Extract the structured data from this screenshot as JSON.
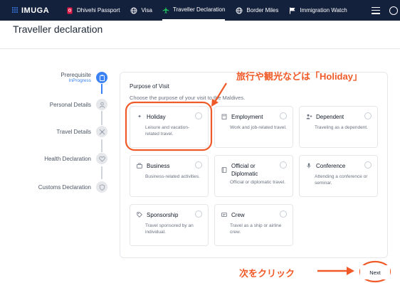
{
  "nav": {
    "logo": "IMUGA",
    "items": [
      {
        "label": "Dhivehi Passport",
        "icon": "passport-icon"
      },
      {
        "label": "Visa",
        "icon": "globe-icon"
      },
      {
        "label": "Traveller Declaration",
        "icon": "airplane-icon"
      },
      {
        "label": "Border Miles",
        "icon": "globe-icon"
      },
      {
        "label": "Immigration Watch",
        "icon": "flag-icon"
      }
    ],
    "right_icons": [
      "menu-icon",
      "chat-icon"
    ]
  },
  "page": {
    "title": "Traveller declaration"
  },
  "stepper": {
    "steps": [
      {
        "label": "Prerequisite",
        "status": "InProgress",
        "icon": "clipboard-icon",
        "active": true
      },
      {
        "label": "Personal Details",
        "icon": "person-icon",
        "active": false
      },
      {
        "label": "Travel Details",
        "icon": "airplane-icon",
        "active": false
      },
      {
        "label": "Health Declaration",
        "icon": "heart-icon",
        "active": false
      },
      {
        "label": "Customs Declaration",
        "icon": "shield-icon",
        "active": false
      }
    ]
  },
  "form": {
    "title": "Purpose of Visit",
    "subtitle": "Choose the purpose of your visit to the Maldives.",
    "options": [
      {
        "label": "Holiday",
        "desc": "Leisure and vacation-related travel.",
        "icon": "sparkle-icon"
      },
      {
        "label": "Employment",
        "desc": "Work and job-related travel.",
        "icon": "building-icon"
      },
      {
        "label": "Dependent",
        "desc": "Traveling as a dependent.",
        "icon": "person-plus-icon"
      },
      {
        "label": "Business",
        "desc": "Business-related activities.",
        "icon": "briefcase-icon"
      },
      {
        "label": "Official or Diplomatic",
        "desc": "Official or diplomatic travel.",
        "icon": "book-icon"
      },
      {
        "label": "Conference",
        "desc": "Attending a conference or seminar.",
        "icon": "microphone-icon"
      },
      {
        "label": "Sponsorship",
        "desc": "Travel sponsored by an individual.",
        "icon": "tag-icon"
      },
      {
        "label": "Crew",
        "desc": "Travel as a ship or airline crew.",
        "icon": "id-card-icon"
      }
    ]
  },
  "annotations": {
    "holiday_note": "旅行や観光などは「Holiday」",
    "next_note": "次をクリック",
    "color": "#f05a28"
  },
  "next_button": {
    "label": "Next"
  },
  "colors": {
    "nav_bg": "#14213d",
    "accent": "#3b82f6"
  }
}
